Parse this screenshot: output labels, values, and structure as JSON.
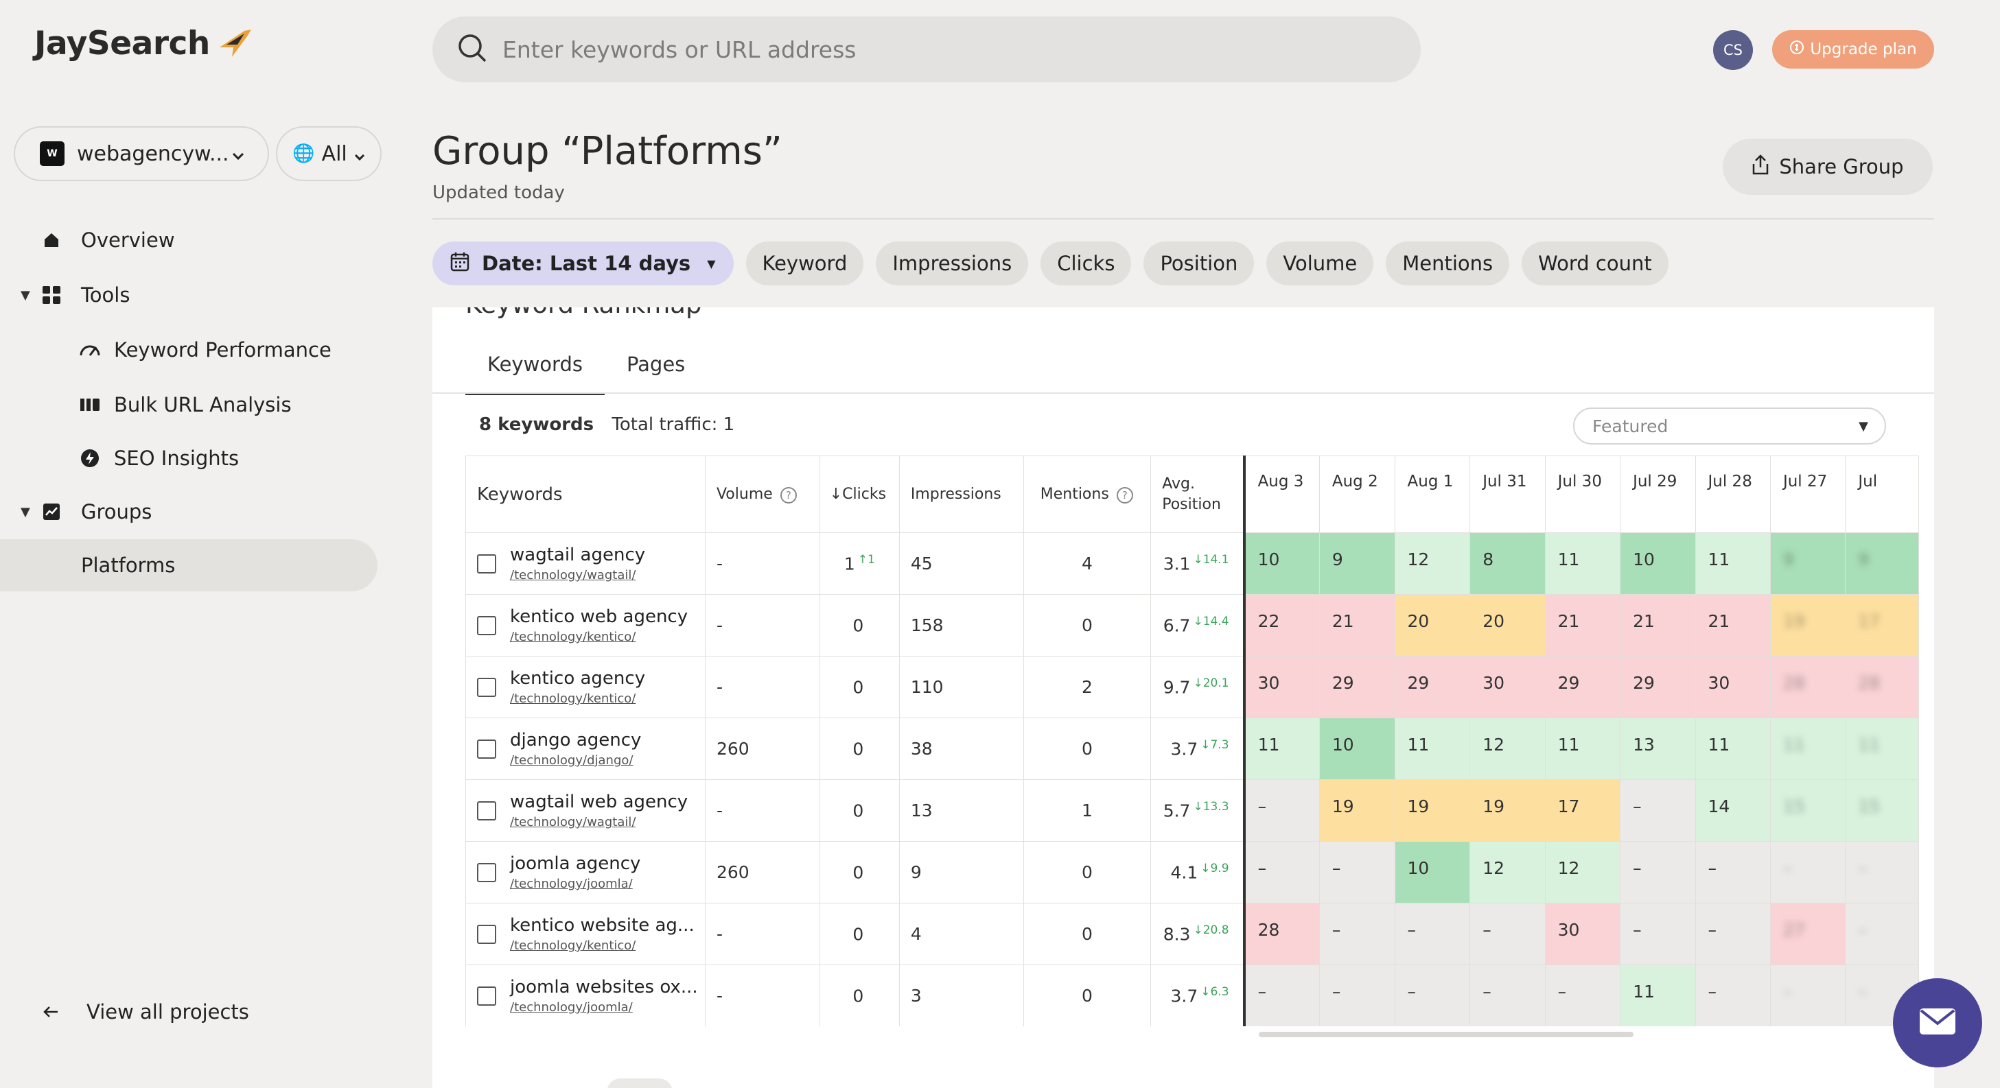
{
  "app": {
    "logo_text": "JaySearch"
  },
  "sidebar": {
    "project": "webagencyw...",
    "scope": "All",
    "items": [
      {
        "label": "Overview",
        "icon": "home-icon"
      },
      {
        "label": "Tools",
        "icon": "grid-icon"
      },
      {
        "label": "Keyword Performance",
        "icon": "performance-icon"
      },
      {
        "label": "Bulk URL Analysis",
        "icon": "bulk-icon"
      },
      {
        "label": "SEO Insights",
        "icon": "bolt-icon"
      },
      {
        "label": "Groups",
        "icon": "chart-icon"
      },
      {
        "label": "Platforms"
      }
    ],
    "view_all": "View all projects"
  },
  "header": {
    "search_placeholder": "Enter keywords or URL address",
    "avatar": "CS",
    "upgrade": "Upgrade plan"
  },
  "page": {
    "title": "Group “Platforms”",
    "subtitle": "Updated today",
    "share": "Share Group",
    "filters": {
      "date": "Date: Last 14 days",
      "keyword": "Keyword",
      "impressions": "Impressions",
      "clicks": "Clicks",
      "position": "Position",
      "volume": "Volume",
      "mentions": "Mentions",
      "word_count": "Word count"
    }
  },
  "card": {
    "title": "Keyword Rankmap",
    "tabs": [
      "Keywords",
      "Pages"
    ],
    "count": "8 keywords",
    "traffic": "Total traffic: 1",
    "sort": "Featured"
  },
  "table": {
    "headers": {
      "keywords": "Keywords",
      "volume": "Volume",
      "clicks": "Clicks",
      "impressions": "Impressions",
      "mentions": "Mentions",
      "avg_position_1": "Avg.",
      "avg_position_2": "Position"
    },
    "days": [
      "Aug 3",
      "Aug 2",
      "Aug 1",
      "Jul 31",
      "Jul 30",
      "Jul 29",
      "Jul 28",
      "Jul 27",
      "Jul"
    ],
    "rows": [
      {
        "kw": "wagtail agency",
        "url": "/technology/wagtail/",
        "volume": "-",
        "clicks": "1",
        "clicks_delta": "↑1",
        "impressions": "45",
        "mentions": "4",
        "pos": "3.1",
        "pos_delta": "↓14.1",
        "hm": [
          {
            "v": "10",
            "c": "dg"
          },
          {
            "v": "9",
            "c": "dg"
          },
          {
            "v": "12",
            "c": "lg"
          },
          {
            "v": "8",
            "c": "dg"
          },
          {
            "v": "11",
            "c": "lg"
          },
          {
            "v": "10",
            "c": "dg"
          },
          {
            "v": "11",
            "c": "lg"
          },
          {
            "v": "9",
            "c": "dg"
          },
          {
            "v": "9",
            "c": "dg"
          }
        ]
      },
      {
        "kw": "kentico web agency",
        "url": "/technology/kentico/",
        "volume": "-",
        "clicks": "0",
        "clicks_delta": "",
        "impressions": "158",
        "mentions": "0",
        "pos": "6.7",
        "pos_delta": "↓14.4",
        "hm": [
          {
            "v": "22",
            "c": "pk"
          },
          {
            "v": "21",
            "c": "pk"
          },
          {
            "v": "20",
            "c": "yl"
          },
          {
            "v": "20",
            "c": "yl"
          },
          {
            "v": "21",
            "c": "pk"
          },
          {
            "v": "21",
            "c": "pk"
          },
          {
            "v": "21",
            "c": "pk"
          },
          {
            "v": "19",
            "c": "yl"
          },
          {
            "v": "17",
            "c": "yl"
          }
        ]
      },
      {
        "kw": "kentico agency",
        "url": "/technology/kentico/",
        "volume": "-",
        "clicks": "0",
        "clicks_delta": "",
        "impressions": "110",
        "mentions": "2",
        "pos": "9.7",
        "pos_delta": "↓20.1",
        "hm": [
          {
            "v": "30",
            "c": "pk"
          },
          {
            "v": "29",
            "c": "pk"
          },
          {
            "v": "29",
            "c": "pk"
          },
          {
            "v": "30",
            "c": "pk"
          },
          {
            "v": "29",
            "c": "pk"
          },
          {
            "v": "29",
            "c": "pk"
          },
          {
            "v": "30",
            "c": "pk"
          },
          {
            "v": "28",
            "c": "pk"
          },
          {
            "v": "28",
            "c": "pk"
          }
        ]
      },
      {
        "kw": "django agency",
        "url": "/technology/django/",
        "volume": "260",
        "clicks": "0",
        "clicks_delta": "",
        "impressions": "38",
        "mentions": "0",
        "pos": "3.7",
        "pos_delta": "↓7.3",
        "hm": [
          {
            "v": "11",
            "c": "lg"
          },
          {
            "v": "10",
            "c": "dg"
          },
          {
            "v": "11",
            "c": "lg"
          },
          {
            "v": "12",
            "c": "lg"
          },
          {
            "v": "11",
            "c": "lg"
          },
          {
            "v": "13",
            "c": "lg"
          },
          {
            "v": "11",
            "c": "lg"
          },
          {
            "v": "11",
            "c": "lg"
          },
          {
            "v": "11",
            "c": "lg"
          }
        ]
      },
      {
        "kw": "wagtail web agency",
        "url": "/technology/wagtail/",
        "volume": "-",
        "clicks": "0",
        "clicks_delta": "",
        "impressions": "13",
        "mentions": "1",
        "pos": "5.7",
        "pos_delta": "↓13.3",
        "hm": [
          {
            "v": "–",
            "c": "gy"
          },
          {
            "v": "19",
            "c": "yl"
          },
          {
            "v": "19",
            "c": "yl"
          },
          {
            "v": "19",
            "c": "yl"
          },
          {
            "v": "17",
            "c": "yl"
          },
          {
            "v": "–",
            "c": "gy"
          },
          {
            "v": "14",
            "c": "lg"
          },
          {
            "v": "15",
            "c": "lg"
          },
          {
            "v": "15",
            "c": "lg"
          }
        ]
      },
      {
        "kw": "joomla agency",
        "url": "/technology/joomla/",
        "volume": "260",
        "clicks": "0",
        "clicks_delta": "",
        "impressions": "9",
        "mentions": "0",
        "pos": "4.1",
        "pos_delta": "↓9.9",
        "hm": [
          {
            "v": "–",
            "c": "gy"
          },
          {
            "v": "–",
            "c": "gy"
          },
          {
            "v": "10",
            "c": "dg"
          },
          {
            "v": "12",
            "c": "lg"
          },
          {
            "v": "12",
            "c": "lg"
          },
          {
            "v": "–",
            "c": "gy"
          },
          {
            "v": "–",
            "c": "gy"
          },
          {
            "v": "–",
            "c": "gy"
          },
          {
            "v": "–",
            "c": "gy"
          }
        ]
      },
      {
        "kw": "kentico website ag...",
        "url": "/technology/kentico/",
        "volume": "-",
        "clicks": "0",
        "clicks_delta": "",
        "impressions": "4",
        "mentions": "0",
        "pos": "8.3",
        "pos_delta": "↓20.8",
        "hm": [
          {
            "v": "28",
            "c": "pk"
          },
          {
            "v": "–",
            "c": "gy"
          },
          {
            "v": "–",
            "c": "gy"
          },
          {
            "v": "–",
            "c": "gy"
          },
          {
            "v": "30",
            "c": "pk"
          },
          {
            "v": "–",
            "c": "gy"
          },
          {
            "v": "–",
            "c": "gy"
          },
          {
            "v": "27",
            "c": "pk"
          },
          {
            "v": "–",
            "c": "gy"
          }
        ]
      },
      {
        "kw": "joomla websites ox...",
        "url": "/technology/joomla/",
        "volume": "-",
        "clicks": "0",
        "clicks_delta": "",
        "impressions": "3",
        "mentions": "0",
        "pos": "3.7",
        "pos_delta": "↓6.3",
        "hm": [
          {
            "v": "–",
            "c": "gy"
          },
          {
            "v": "–",
            "c": "gy"
          },
          {
            "v": "–",
            "c": "gy"
          },
          {
            "v": "–",
            "c": "gy"
          },
          {
            "v": "–",
            "c": "gy"
          },
          {
            "v": "11",
            "c": "lg"
          },
          {
            "v": "–",
            "c": "gy"
          },
          {
            "v": "–",
            "c": "gy"
          },
          {
            "v": "–",
            "c": "gy"
          }
        ]
      }
    ]
  },
  "colors": {
    "dark_green": "#a9dfb8",
    "light_green": "#d8f2de",
    "pink": "#f9d3d6",
    "yellow": "#fde0a0",
    "gray": "#eceae8",
    "accent": "#4a4496",
    "upgrade": "#f0a07a"
  }
}
